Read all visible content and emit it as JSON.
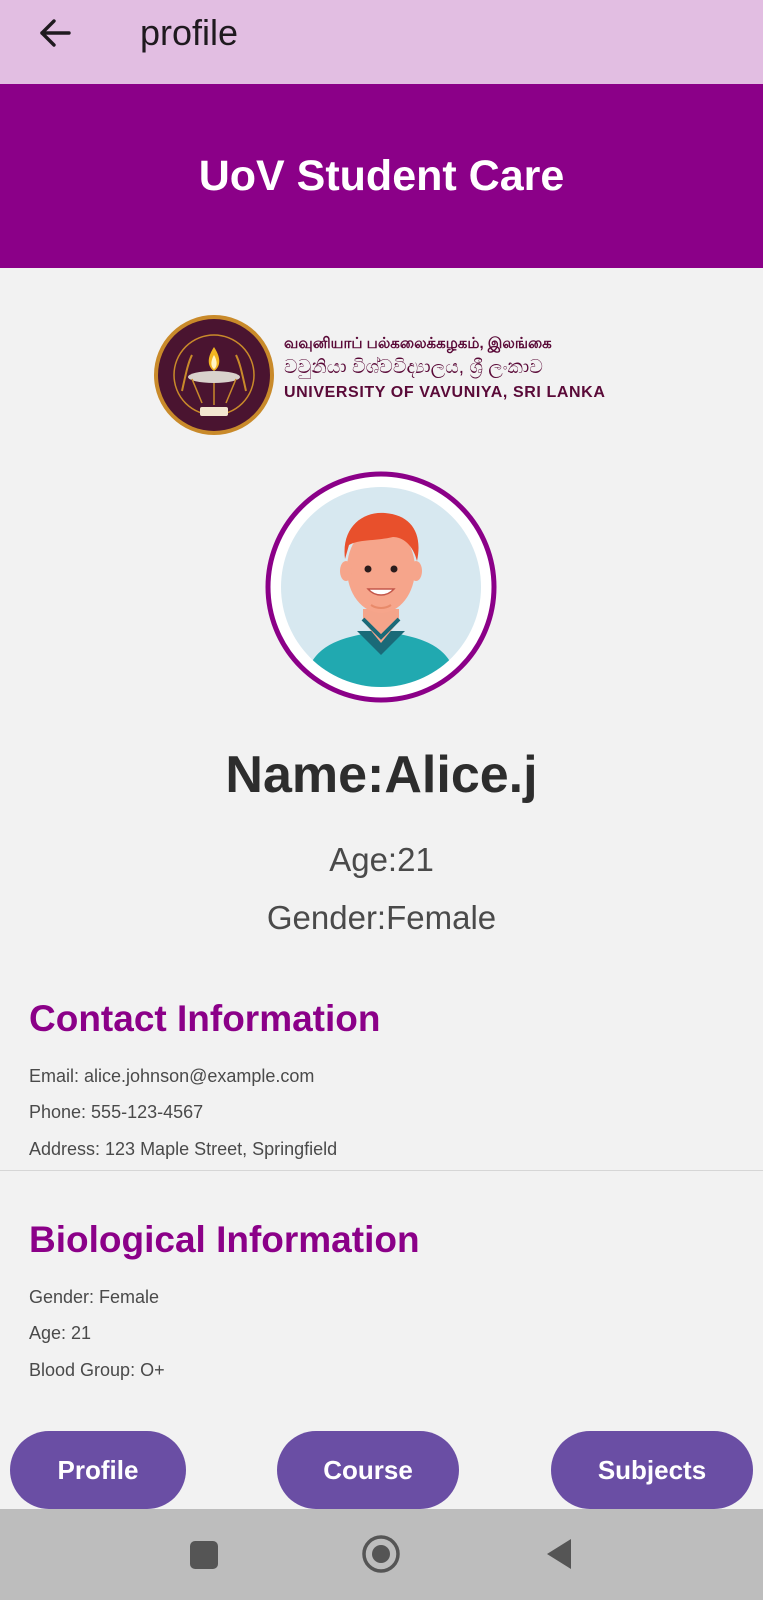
{
  "appbar": {
    "title": "profile",
    "back_icon": "arrow-left-icon"
  },
  "banner": {
    "title": "UoV Student Care",
    "background": "#8b0088"
  },
  "logo": {
    "line1": "வவுனியாப் பல்கலைக்கழகம், இலங்கை",
    "line2": "වවුනියා විශ්වවිද්‍යාලය, ශ්‍රී ලංකාව",
    "line3": "UNIVERSITY OF VAVUNIYA, SRI LANKA"
  },
  "profile": {
    "name": "Name:Alice.j",
    "age": "Age:21",
    "gender": "Gender:Female"
  },
  "contact": {
    "heading": "Contact Information",
    "email": "Email: alice.johnson@example.com",
    "phone": "Phone: 555-123-4567",
    "address": "Address: 123 Maple Street, Springfield"
  },
  "biological": {
    "heading": "Biological Information",
    "gender": "Gender: Female",
    "age": "Age: 21",
    "blood_group": "Blood Group: O+"
  },
  "bottom_nav": {
    "profile_label": "Profile",
    "course_label": "Course",
    "subjects_label": "Subjects"
  },
  "colors": {
    "appbar": "#e2bee2",
    "accent_purple": "#8b0088",
    "button_purple": "#6a4ea4",
    "system_bar": "#bdbdbd"
  },
  "system_nav": {
    "recents_icon": "square-icon",
    "home_icon": "circle-home-icon",
    "back_icon": "triangle-back-icon"
  }
}
